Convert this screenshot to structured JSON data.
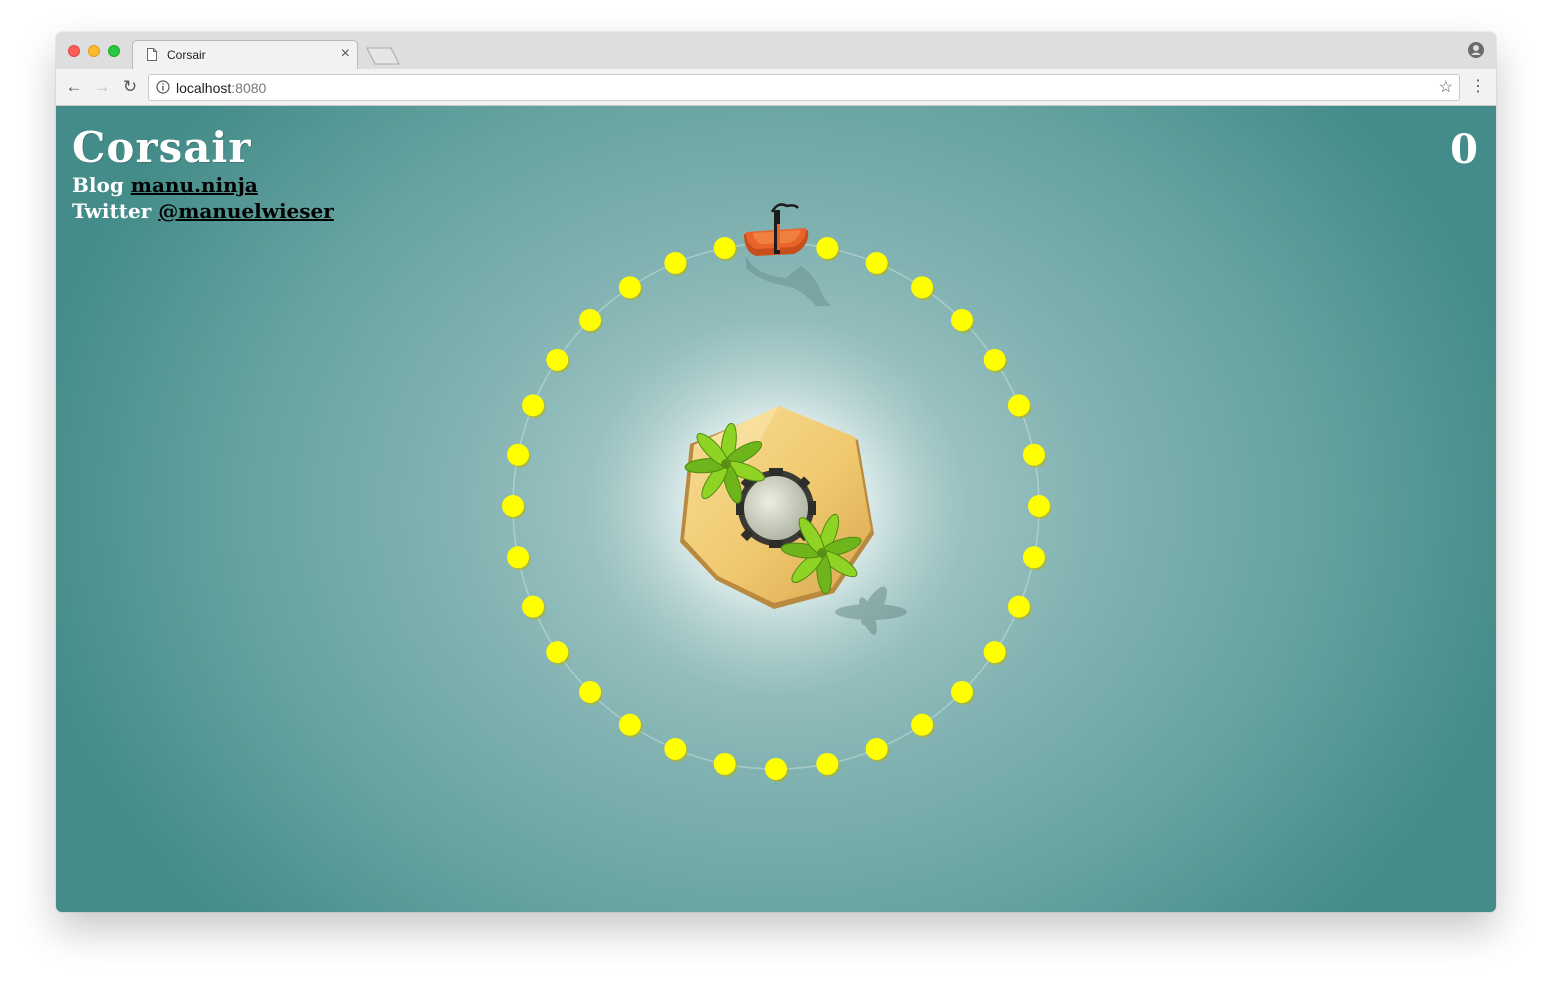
{
  "browser": {
    "tab_title": "Corsair",
    "url_host": "localhost",
    "url_port": ":8080"
  },
  "hud": {
    "title": "Corsair",
    "blog_label": "Blog",
    "blog_link": "manu.ninja",
    "twitter_label": "Twitter",
    "twitter_link": "@manuelwieser",
    "score": "0"
  },
  "scene": {
    "coin_count": 32,
    "colors": {
      "ocean_center": "#dfeeee",
      "ocean_edge": "#438c89",
      "coin": "#ffff00",
      "sand": "#f2cf7c",
      "palm": "#7fc820",
      "ship": "#e8622a",
      "tower": "#d0d4c4"
    }
  }
}
